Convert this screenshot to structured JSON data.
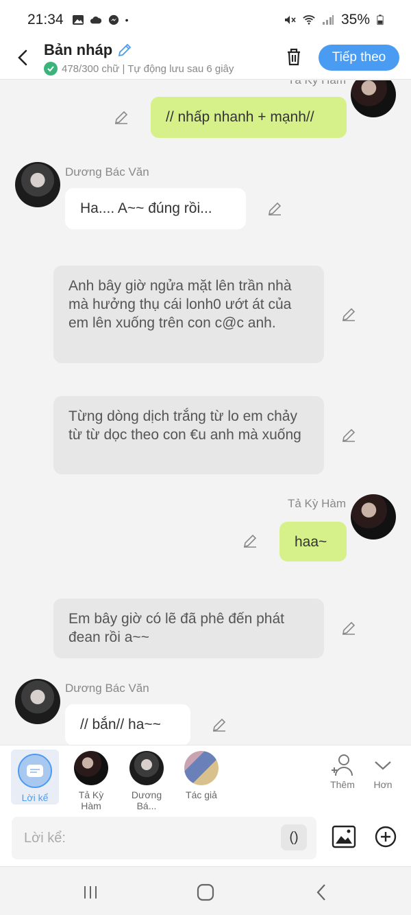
{
  "status": {
    "time": "21:34",
    "battery": "35%"
  },
  "header": {
    "title": "Bản nháp",
    "subtitle": "478/300 chữ | Tự động lưu sau 6 giây",
    "next_label": "Tiếp theo"
  },
  "messages": [
    {
      "speaker": "Tả Kỳ Hàm",
      "text": "// nhấp nhanh + mạnh//"
    },
    {
      "speaker": "Dương Bác Văn",
      "text": "Ha....  A~~ đúng rồi..."
    },
    {
      "text": "Anh bây giờ ngửa mặt lên trần nhà mà hưởng thụ cái lonh0 ướt át của em lên xuống trên con c@c anh."
    },
    {
      "text": "Từng dòng dịch trắng từ lo em chảy từ từ dọc theo con €u anh mà xuống"
    },
    {
      "speaker": "Tả Kỳ Hàm",
      "text": "haa~"
    },
    {
      "text": "Em bây giờ có lẽ đã phê đến phát đean rồi a~~"
    },
    {
      "speaker": "Dương Bác Văn",
      "text": "// bắn// ha~~"
    }
  ],
  "characters": [
    {
      "label": "Lời kể"
    },
    {
      "label": "Tả Kỳ Hàm"
    },
    {
      "label": "Dương Bá..."
    },
    {
      "label": "Tác giả"
    }
  ],
  "tools": {
    "add_label": "Thêm",
    "more_label": "Hơn"
  },
  "input": {
    "placeholder": "Lời kể:",
    "paren": "()"
  },
  "colors": {
    "accent": "#4a9cf2",
    "green_bubble": "#d6f08a",
    "gray_bubble": "#e7e7e7"
  }
}
